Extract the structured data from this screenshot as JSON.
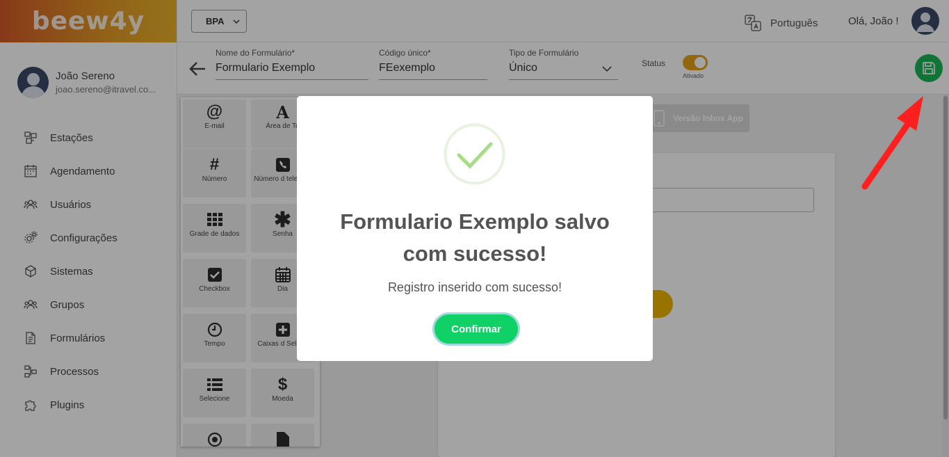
{
  "app": {
    "logo": "beew4y"
  },
  "user": {
    "name": "João Sereno",
    "email": "joao.sereno@itravel.co..."
  },
  "sidebar": {
    "items": [
      {
        "label": "Estações",
        "icon": "stations-icon"
      },
      {
        "label": "Agendamento",
        "icon": "calendar-icon"
      },
      {
        "label": "Usuários",
        "icon": "users-icon"
      },
      {
        "label": "Configurações",
        "icon": "gears-icon"
      },
      {
        "label": "Sistemas",
        "icon": "cube-icon"
      },
      {
        "label": "Grupos",
        "icon": "group-icon"
      },
      {
        "label": "Formulários",
        "icon": "document-icon"
      },
      {
        "label": "Processos",
        "icon": "process-icon"
      },
      {
        "label": "Plugins",
        "icon": "puzzle-icon"
      }
    ]
  },
  "topbar": {
    "company": "BPA",
    "language": "Português",
    "greeting": "Olá, João !"
  },
  "form": {
    "name_label": "Nome do Formulário*",
    "name_value": "Formulario Exemplo",
    "code_label": "Código único*",
    "code_value": "FEexemplo",
    "type_label": "Tipo de Formulário",
    "type_value": "Único",
    "status_label": "Status",
    "status_state": "Ativado"
  },
  "palette": {
    "tiles": [
      {
        "label": "E-mail",
        "icon": "at-icon"
      },
      {
        "label": "Área de Te",
        "icon": "text-area-icon"
      },
      {
        "label": "Número",
        "icon": "hash-icon"
      },
      {
        "label": "Número d telefone",
        "icon": "phone-icon"
      },
      {
        "label": "Grade de dados",
        "icon": "grid-icon"
      },
      {
        "label": "Senha",
        "icon": "asterisk-icon"
      },
      {
        "label": "Checkbox",
        "icon": "checkbox-icon"
      },
      {
        "label": "Dia",
        "icon": "calendar-grid-icon"
      },
      {
        "label": "Tempo",
        "icon": "clock-icon"
      },
      {
        "label": "Caixas d Seleçã",
        "icon": "plus-box-icon"
      },
      {
        "label": "Selecione",
        "icon": "list-icon"
      },
      {
        "label": "Moeda",
        "icon": "dollar-icon"
      },
      {
        "label": "",
        "icon": "radio-icon"
      },
      {
        "label": "",
        "icon": "file-icon"
      }
    ]
  },
  "preview": {
    "inbox_label": "Versão Inbox App"
  },
  "modal": {
    "title_line1": "Formulario Exemplo salvo",
    "title_line2": "com sucesso!",
    "message": "Registro inserido com sucesso!",
    "confirm_label": "Confirmar"
  },
  "colors": {
    "brand_orange": "#d35a28",
    "brand_gold": "#e9b22a",
    "save_green": "#1bb657",
    "confirm_green": "#0fd165",
    "toggle_gold": "#e3a21a",
    "annotation_red": "#ff1f1f"
  }
}
